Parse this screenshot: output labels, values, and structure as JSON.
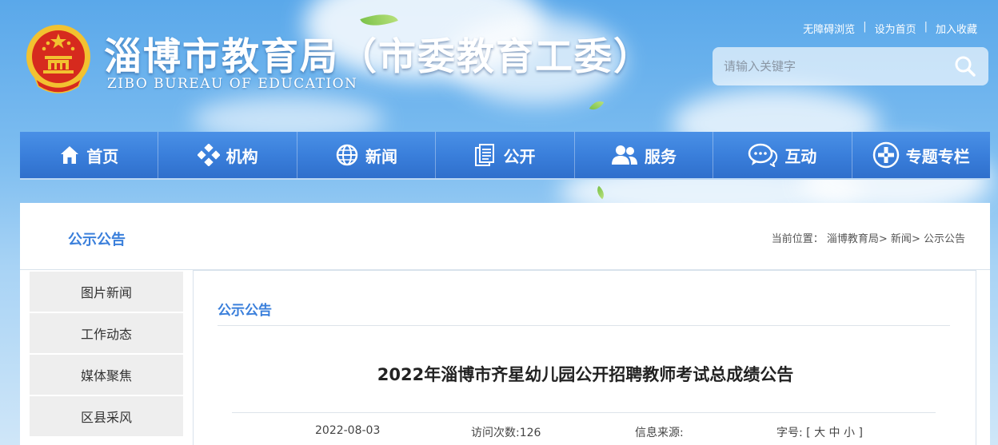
{
  "header": {
    "title": "淄博市教育局（市委教育工委）",
    "subtitle": "ZIBO BUREAU OF EDUCATION",
    "top_links": [
      "无障碍浏览",
      "设为首页",
      "加入收藏"
    ],
    "search_placeholder": "请输入关键字"
  },
  "nav": {
    "items": [
      {
        "label": "首页",
        "icon": "home-icon"
      },
      {
        "label": "机构",
        "icon": "org-icon"
      },
      {
        "label": "新闻",
        "icon": "globe-icon"
      },
      {
        "label": "公开",
        "icon": "documents-icon"
      },
      {
        "label": "服务",
        "icon": "users-icon"
      },
      {
        "label": "互动",
        "icon": "chat-icon"
      },
      {
        "label": "专题专栏",
        "icon": "plus-circle-icon"
      }
    ]
  },
  "page": {
    "section_title": "公示公告",
    "breadcrumb": {
      "prefix": "当前位置：",
      "items": [
        "淄博教育局",
        "新闻",
        "公示公告"
      ],
      "separator": ">"
    }
  },
  "sidebar": {
    "items": [
      "图片新闻",
      "工作动态",
      "媒体聚焦",
      "区县采风"
    ]
  },
  "article": {
    "category": "公示公告",
    "title": "2022年淄博市齐星幼儿园公开招聘教师考试总成绩公告",
    "date": "2022-08-03",
    "visits_label": "访问次数:",
    "visits": "126",
    "source_label": "信息来源:",
    "source": "",
    "font_size_label": "字号:",
    "font_size_options": [
      "大",
      "中",
      "小"
    ]
  },
  "colors": {
    "accent": "#3a7fdb",
    "nav_top": "#4a90e6",
    "nav_bottom": "#2f6fcc",
    "emblem_red": "#d62a1e",
    "emblem_gold": "#f2c230"
  }
}
